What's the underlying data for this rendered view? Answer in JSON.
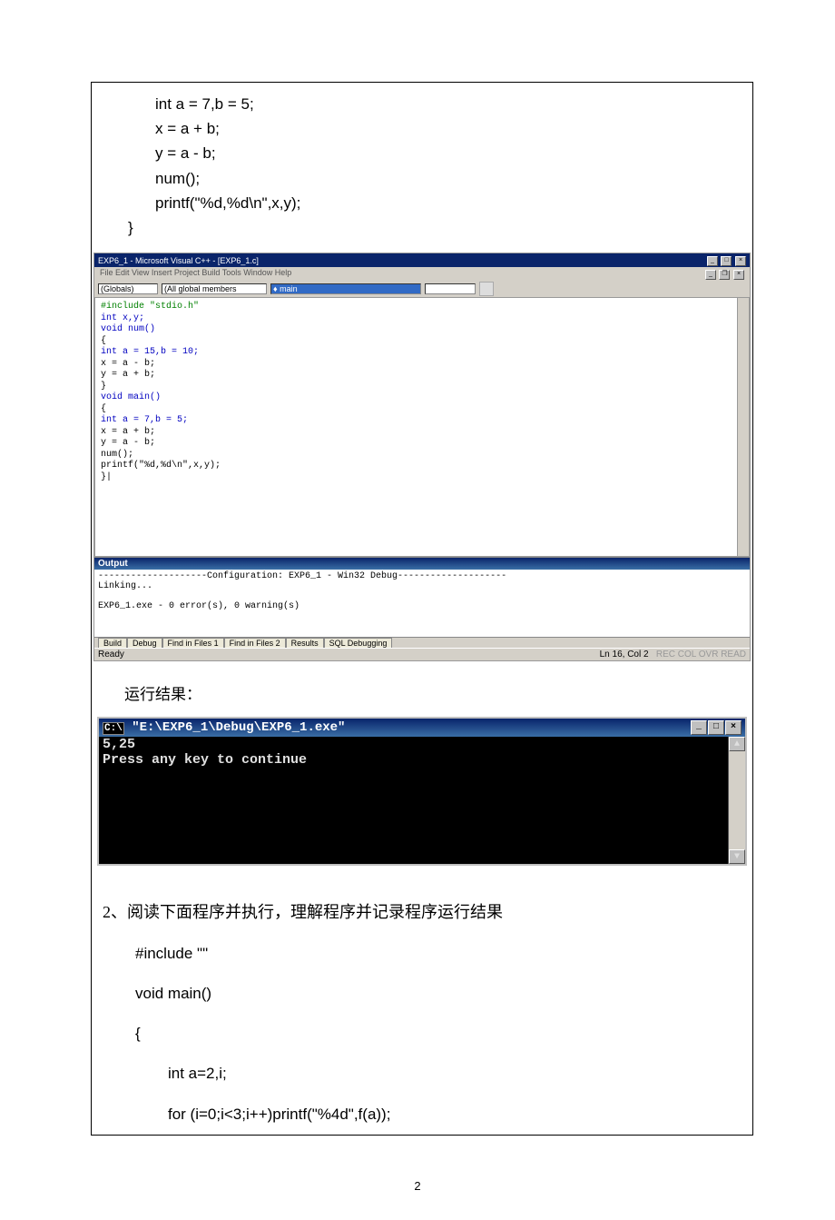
{
  "code_top": {
    "l1": "int a = 7,b = 5;",
    "l2": "x = a + b;",
    "l3": "y = a - b;",
    "l4": "num();",
    "l5": "printf(\"%d,%d\\n\",x,y);",
    "l6": "}"
  },
  "ide": {
    "title": "EXP6_1 - Microsoft Visual C++ - [EXP6_1.c]",
    "menu": "File  Edit  View  Insert  Project  Build  Tools  Window  Help",
    "scope": "(Globals)",
    "members": "(All global members",
    "func": "main",
    "src": {
      "l1": "#include \"stdio.h\"",
      "l2": "int x,y;",
      "l3": "void num()",
      "l4": "{",
      "l5": "    int a = 15,b = 10;",
      "l6": "    x = a - b;",
      "l7": "    y = a + b;",
      "l8": "}",
      "l9": "void main()",
      "l10": "{",
      "l11": "    int a = 7,b = 5;",
      "l12": "    x = a + b;",
      "l13": "    y = a - b;",
      "l14": "    num();",
      "l15": "    printf(\"%d,%d\\n\",x,y);",
      "l16": "}|"
    },
    "output": {
      "title": "Output",
      "cfg": "--------------------Configuration: EXP6_1 - Win32 Debug--------------------",
      "linking": "Linking...",
      "result": "EXP6_1.exe - 0 error(s), 0 warning(s)",
      "tabs": {
        "t1": "Build",
        "t2": "Debug",
        "t3": "Find in Files 1",
        "t4": "Find in Files 2",
        "t5": "Results",
        "t6": "SQL Debugging"
      }
    },
    "status": {
      "left": "Ready",
      "right": "Ln 16, Col 2",
      "dim": "REC COL OVR READ"
    }
  },
  "section_label": "运行结果：",
  "console": {
    "title": "\"E:\\EXP6_1\\Debug\\EXP6_1.exe\"",
    "line1": "5,25",
    "line2": "Press any key to continue"
  },
  "q2": {
    "heading": "2、阅读下面程序并执行，理解程序并记录程序运行结果",
    "c1": "#include \"\"",
    "c2": "void main()",
    "c3": "{",
    "c4": "int a=2,i;",
    "c5": "for (i=0;i<3;i++)printf(\"%4d\",f(a));"
  },
  "page_num": "2"
}
